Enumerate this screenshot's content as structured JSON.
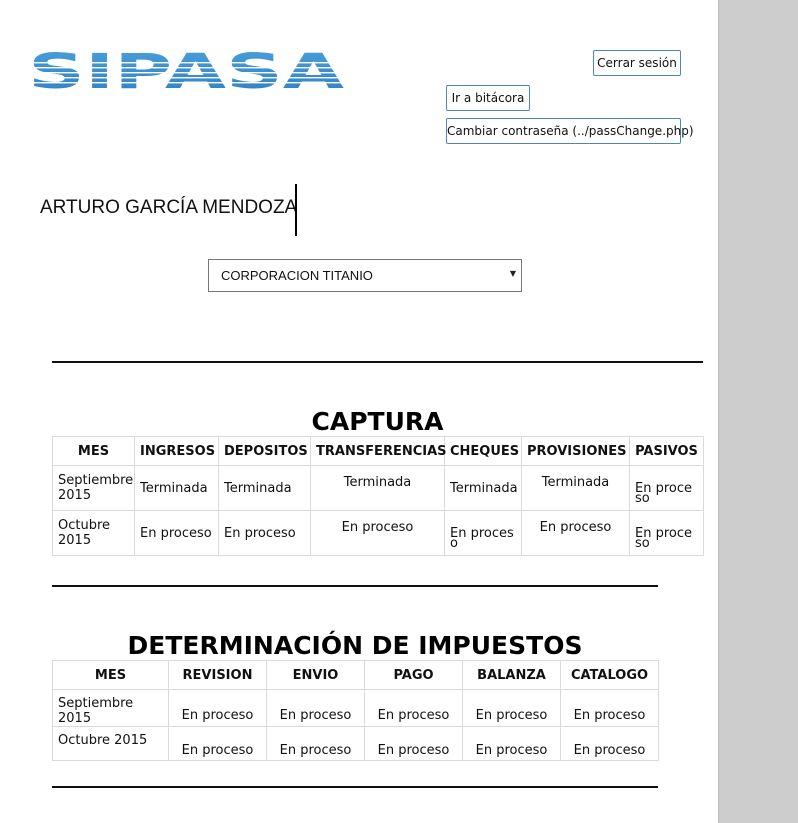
{
  "header": {
    "logo_text": "SIPASA",
    "buttons": {
      "logout": "Cerrar sesión",
      "log": "Ir a bitácora",
      "change_password": "Cambiar contraseña (../passChange.php)"
    }
  },
  "user": {
    "name": "ARTURO GARCÍA MENDOZA"
  },
  "company_select": {
    "selected": "CORPORACION TITANIO"
  },
  "captura": {
    "title": "CAPTURA",
    "columns": [
      "MES",
      "INGRESOS",
      "DEPOSITOS",
      "TRANSFERENCIAS",
      "CHEQUES",
      "PROVISIONES",
      "PASIVOS"
    ],
    "rows": [
      [
        "Septiembre 2015",
        "Terminada",
        "Terminada",
        "Terminada",
        "Terminada",
        "Terminada",
        "En proceso"
      ],
      [
        "Octubre 2015",
        "En proceso",
        "En proceso",
        "En proceso",
        "En proceso",
        "En proceso",
        "En proceso"
      ]
    ]
  },
  "impuestos": {
    "title": "DETERMINACIÓN DE IMPUESTOS",
    "columns": [
      "MES",
      "REVISION",
      "ENVIO",
      "PAGO",
      "BALANZA",
      "CATALOGO"
    ],
    "rows": [
      [
        "Septiembre 2015",
        "En proceso",
        "En proceso",
        "En proceso",
        "En proceso",
        "En proceso"
      ],
      [
        "Octubre 2015",
        "En proceso",
        "En proceso",
        "En proceso",
        "En proceso",
        "En proceso"
      ]
    ]
  },
  "colors": {
    "logo_blue": "#3d8fd0",
    "button_border": "#4a86c7",
    "gutter": "#cdcdcd"
  }
}
